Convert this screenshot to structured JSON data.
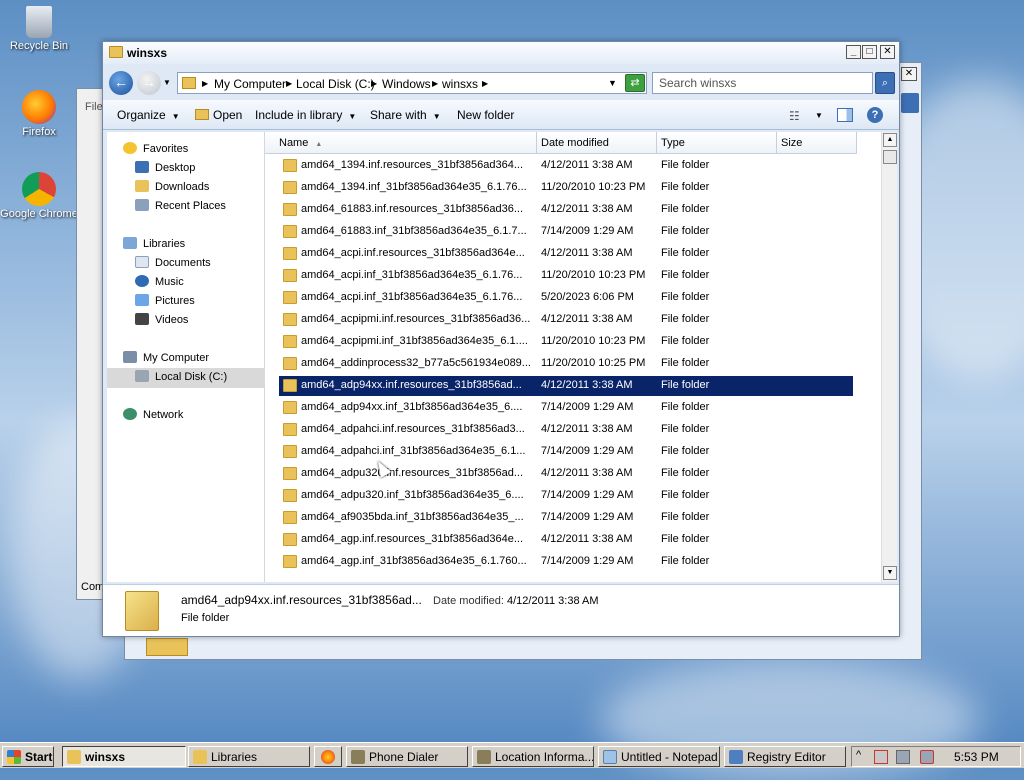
{
  "desktop": {
    "icons": [
      {
        "label": "Recycle Bin"
      },
      {
        "label": "Firefox"
      },
      {
        "label": "Google Chrome"
      }
    ]
  },
  "bgwindow": {
    "partial_text_top": "File",
    "partial_text_bottom": "Com"
  },
  "window": {
    "title": "winsxs",
    "controls": {
      "minimize": "_",
      "maximize": "□",
      "close": "✕"
    }
  },
  "address": {
    "crumbs": [
      "My Computer",
      "Local Disk (C:)",
      "Windows",
      "winsxs"
    ],
    "search_placeholder": "Search winsxs"
  },
  "toolbar": {
    "organize": "Organize",
    "open": "Open",
    "include": "Include in library",
    "share": "Share with",
    "newfolder": "New folder"
  },
  "nav": {
    "favorites": "Favorites",
    "desktop": "Desktop",
    "downloads": "Downloads",
    "recent": "Recent Places",
    "libraries": "Libraries",
    "documents": "Documents",
    "music": "Music",
    "pictures": "Pictures",
    "videos": "Videos",
    "mycomputer": "My Computer",
    "localdisk": "Local Disk (C:)",
    "network": "Network"
  },
  "columns": {
    "name": "Name",
    "date": "Date modified",
    "type": "Type",
    "size": "Size"
  },
  "files": [
    {
      "name": "amd64_1394.inf.resources_31bf3856ad364...",
      "date": "4/12/2011 3:38 AM",
      "type": "File folder"
    },
    {
      "name": "amd64_1394.inf_31bf3856ad364e35_6.1.76...",
      "date": "11/20/2010 10:23 PM",
      "type": "File folder"
    },
    {
      "name": "amd64_61883.inf.resources_31bf3856ad36...",
      "date": "4/12/2011 3:38 AM",
      "type": "File folder"
    },
    {
      "name": "amd64_61883.inf_31bf3856ad364e35_6.1.7...",
      "date": "7/14/2009 1:29 AM",
      "type": "File folder"
    },
    {
      "name": "amd64_acpi.inf.resources_31bf3856ad364e...",
      "date": "4/12/2011 3:38 AM",
      "type": "File folder"
    },
    {
      "name": "amd64_acpi.inf_31bf3856ad364e35_6.1.76...",
      "date": "11/20/2010 10:23 PM",
      "type": "File folder"
    },
    {
      "name": "amd64_acpi.inf_31bf3856ad364e35_6.1.76...",
      "date": "5/20/2023 6:06 PM",
      "type": "File folder"
    },
    {
      "name": "amd64_acpipmi.inf.resources_31bf3856ad36...",
      "date": "4/12/2011 3:38 AM",
      "type": "File folder"
    },
    {
      "name": "amd64_acpipmi.inf_31bf3856ad364e35_6.1....",
      "date": "11/20/2010 10:23 PM",
      "type": "File folder"
    },
    {
      "name": "amd64_addinprocess32_b77a5c561934e089...",
      "date": "11/20/2010 10:25 PM",
      "type": "File folder"
    },
    {
      "name": "amd64_adp94xx.inf.resources_31bf3856ad...",
      "date": "4/12/2011 3:38 AM",
      "type": "File folder"
    },
    {
      "name": "amd64_adp94xx.inf_31bf3856ad364e35_6....",
      "date": "7/14/2009 1:29 AM",
      "type": "File folder"
    },
    {
      "name": "amd64_adpahci.inf.resources_31bf3856ad3...",
      "date": "4/12/2011 3:38 AM",
      "type": "File folder"
    },
    {
      "name": "amd64_adpahci.inf_31bf3856ad364e35_6.1...",
      "date": "7/14/2009 1:29 AM",
      "type": "File folder"
    },
    {
      "name": "amd64_adpu320.inf.resources_31bf3856ad...",
      "date": "4/12/2011 3:38 AM",
      "type": "File folder"
    },
    {
      "name": "amd64_adpu320.inf_31bf3856ad364e35_6....",
      "date": "7/14/2009 1:29 AM",
      "type": "File folder"
    },
    {
      "name": "amd64_af9035bda.inf_31bf3856ad364e35_...",
      "date": "7/14/2009 1:29 AM",
      "type": "File folder"
    },
    {
      "name": "amd64_agp.inf.resources_31bf3856ad364e...",
      "date": "4/12/2011 3:38 AM",
      "type": "File folder"
    },
    {
      "name": "amd64_agp.inf_31bf3856ad364e35_6.1.760...",
      "date": "7/14/2009 1:29 AM",
      "type": "File folder"
    }
  ],
  "details": {
    "name": "amd64_adp94xx.inf.resources_31bf3856ad...",
    "date_label": "Date modified:",
    "date": "4/12/2011 3:38 AM",
    "type": "File folder"
  },
  "taskbar": {
    "start": "Start",
    "buttons": [
      "winsxs",
      "Libraries",
      "Phone Dialer",
      "Location Informa...",
      "Untitled - Notepad",
      "Registry Editor"
    ],
    "clock": "5:53 PM"
  },
  "colors": {
    "selection": "#0a246a",
    "folder": "#e9c35a",
    "accent": "#3d6fb4"
  }
}
